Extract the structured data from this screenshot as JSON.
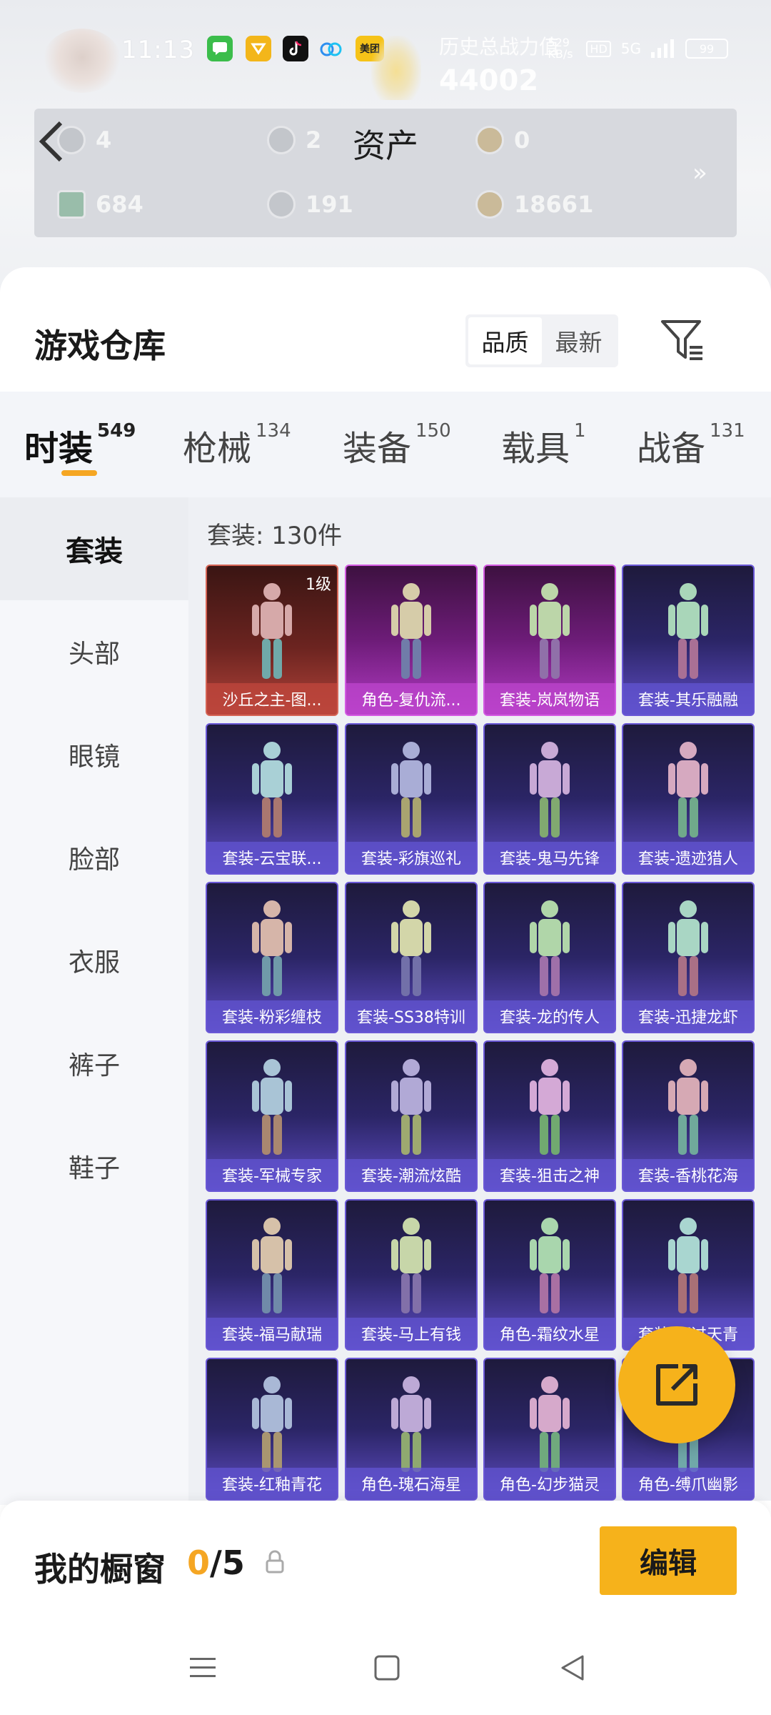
{
  "status_bar": {
    "time": "11:13",
    "history_label": "历史总战力值",
    "history_value": "44002",
    "network": "529 KB/s",
    "hd": "HD",
    "signal": "5G",
    "battery": "99",
    "app_icons": [
      "message-icon",
      "wallet-icon",
      "tiktok-icon",
      "cloud-icon",
      "meituan-icon"
    ],
    "meituan_text": "美团"
  },
  "assets": {
    "title": "资产",
    "items": [
      {
        "icon": "gem-icon",
        "value": "4"
      },
      {
        "icon": "coin-icon",
        "value": "2"
      },
      {
        "icon": "badge-icon",
        "value": "0"
      },
      {
        "icon": "card-icon",
        "value": "684"
      },
      {
        "icon": "silver-coin-icon",
        "value": "191"
      },
      {
        "icon": "gold-coin-icon",
        "value": "18661"
      }
    ],
    "more": "»"
  },
  "warehouse": {
    "title": "游戏仓库",
    "sort_options": [
      "品质",
      "最新"
    ],
    "sort_active": 0
  },
  "tabs": [
    {
      "label": "时装",
      "count": "549"
    },
    {
      "label": "枪械",
      "count": "134"
    },
    {
      "label": "装备",
      "count": "150"
    },
    {
      "label": "载具",
      "count": "1"
    },
    {
      "label": "战备",
      "count": "131"
    }
  ],
  "categories": [
    "套装",
    "头部",
    "眼镜",
    "脸部",
    "衣服",
    "裤子",
    "鞋子"
  ],
  "grid": {
    "count_label": "套装: 130件",
    "items": [
      {
        "name": "沙丘之主-图...",
        "level": "1级",
        "tier": "red"
      },
      {
        "name": "角色-复仇流...",
        "tier": "pink"
      },
      {
        "name": "套装-岚岚物语",
        "tier": "pink"
      },
      {
        "name": "套装-其乐融融",
        "tier": "blue"
      },
      {
        "name": "套装-云宝联...",
        "tier": "blue"
      },
      {
        "name": "套装-彩旗巡礼",
        "tier": "blue"
      },
      {
        "name": "套装-鬼马先锋",
        "tier": "blue"
      },
      {
        "name": "套装-遗迹猎人",
        "tier": "blue"
      },
      {
        "name": "套装-粉彩缠枝",
        "tier": "blue"
      },
      {
        "name": "套装-SS38特训",
        "tier": "blue"
      },
      {
        "name": "套装-龙的传人",
        "tier": "blue"
      },
      {
        "name": "套装-迅捷龙虾",
        "tier": "blue"
      },
      {
        "name": "套装-军械专家",
        "tier": "blue"
      },
      {
        "name": "套装-潮流炫酷",
        "tier": "blue"
      },
      {
        "name": "套装-狙击之神",
        "tier": "blue"
      },
      {
        "name": "套装-香桃花海",
        "tier": "blue"
      },
      {
        "name": "套装-福马献瑞",
        "tier": "blue"
      },
      {
        "name": "套装-马上有钱",
        "tier": "blue"
      },
      {
        "name": "角色-霜纹水星",
        "tier": "blue"
      },
      {
        "name": "套装-雨过天青",
        "tier": "blue"
      },
      {
        "name": "套装-红釉青花",
        "tier": "blue"
      },
      {
        "name": "角色-瑰石海星",
        "tier": "blue"
      },
      {
        "name": "角色-幻步猫灵",
        "tier": "blue"
      },
      {
        "name": "角色-缚爪幽影",
        "tier": "blue"
      }
    ]
  },
  "window": {
    "label": "我的橱窗",
    "current": "0",
    "total": "/5",
    "edit_label": "编辑"
  },
  "colors": {
    "accent": "#f6b21b",
    "tab_underline": "#f5a623",
    "card_blue": "#5e4cc3",
    "card_pink": "#b23ac3",
    "card_red": "#b2433a"
  }
}
